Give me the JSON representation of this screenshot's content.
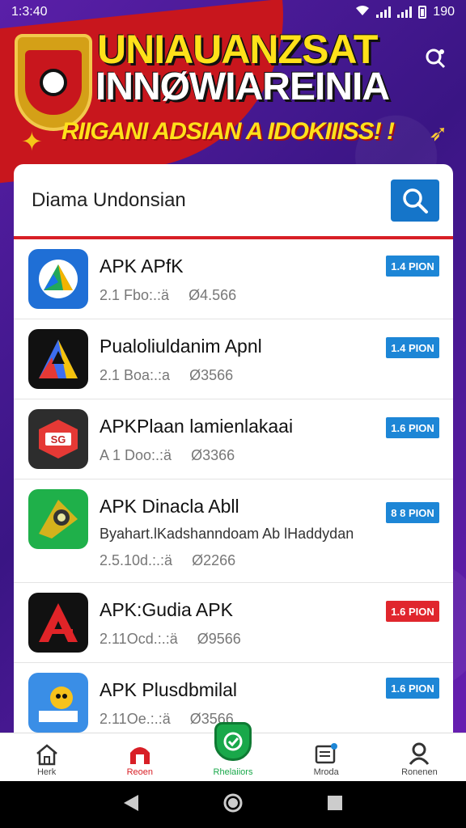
{
  "status_bar": {
    "time": "1:3:40",
    "battery_text": "190"
  },
  "banner": {
    "title_line1": "UNIAUANZSAT",
    "title_line2": "INNØWIAREINIA",
    "tagline": "RIIGANI ADSIAN A IDOKIIISS! !"
  },
  "search": {
    "placeholder": "Diama Undonsian",
    "icon": "search-icon"
  },
  "apps": [
    {
      "name": "APK APfK",
      "desc": "",
      "size": "2.1 Fbo:.:ä",
      "downloads": "Ø4.566",
      "button": "1.4 PION",
      "button_color": "#1d86d6",
      "icon": "drive-triangle-icon"
    },
    {
      "name": "Pualoliuldanim Apnl",
      "desc": "",
      "size": "2.1 Boa:.:a",
      "downloads": "Ø3566",
      "button": "1.4 PION",
      "button_color": "#1d86d6",
      "icon": "delta-logo-icon"
    },
    {
      "name": "APKPlaan lamienlakaai",
      "desc": "",
      "size": "A 1 Doo:.:ä",
      "downloads": "Ø3366",
      "button": "1.6 PION",
      "button_color": "#1d86d6",
      "icon": "red-badge-icon"
    },
    {
      "name": "APK Dinacla Abll",
      "desc": "Byahart.lKadshanndoam Ab lHaddydan",
      "size": "2.5.10d.:.:ä",
      "downloads": "Ø2266",
      "button": "8 8 PION",
      "button_color": "#1d86d6",
      "icon": "camera-lens-icon"
    },
    {
      "name": "APK:Gudia APK",
      "desc": "",
      "size": "2.11Ocd.:.:ä",
      "downloads": "Ø9566",
      "button": "1.6 PION",
      "button_color": "#e0262d",
      "icon": "red-a-logo-icon"
    },
    {
      "name": "APK Plusdbmilal",
      "desc": "",
      "size": "2.11Oe.:.:ä",
      "downloads": "Ø3566",
      "button": "1.6 PION",
      "button_color": "#1d86d6",
      "icon": "sun-character-icon"
    }
  ],
  "bottom_nav": [
    {
      "label": "Herk",
      "icon": "home-icon",
      "color": "#333"
    },
    {
      "label": "Reoen",
      "icon": "store-icon",
      "color": "#d81f26"
    },
    {
      "label": "Rhelaiiors",
      "icon": "shield-check-icon",
      "color": "#19a84a"
    },
    {
      "label": "Mroda",
      "icon": "media-icon",
      "color": "#333"
    },
    {
      "label": "Ronenen",
      "icon": "profile-icon",
      "color": "#333"
    }
  ],
  "colors": {
    "brand_purple": "#4a1a9a",
    "brand_red": "#d81f26",
    "accent_blue": "#1575c9",
    "accent_yellow": "#ffe11a"
  }
}
